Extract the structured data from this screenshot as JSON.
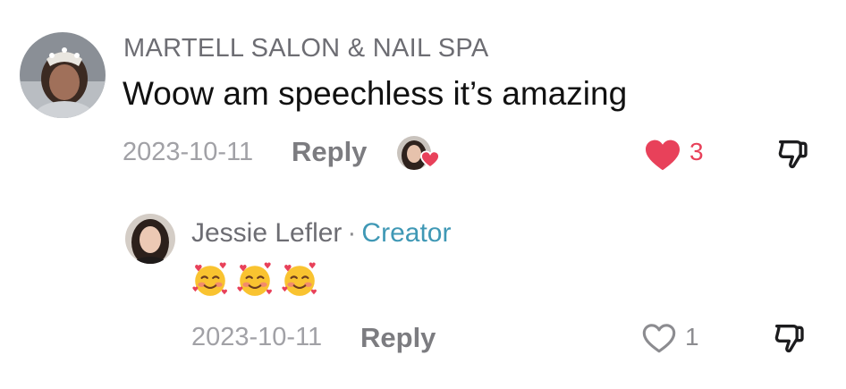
{
  "comment": {
    "username": "MARTELL SALON & NAIL SPA",
    "text": "Woow am speechless it’s amazing",
    "date": "2023-10-11",
    "reply_label": "Reply",
    "like_count": "3",
    "liked": true,
    "liked_by_creator": true
  },
  "reply": {
    "username": "Jessie Lefler",
    "separator": "·",
    "badge": "Creator",
    "emoji_text": "🥰🥰🥰",
    "date": "2023-10-11",
    "reply_label": "Reply",
    "like_count": "1",
    "liked": false
  },
  "colors": {
    "username_gray": "#6d6d73",
    "meta_gray": "#a1a1a6",
    "like_red": "#e8415a",
    "creator_blue": "#3f98b5"
  },
  "icons": [
    "heart-filled-icon",
    "heart-outline-icon",
    "thumbs-down-icon",
    "heart-badge-icon"
  ]
}
